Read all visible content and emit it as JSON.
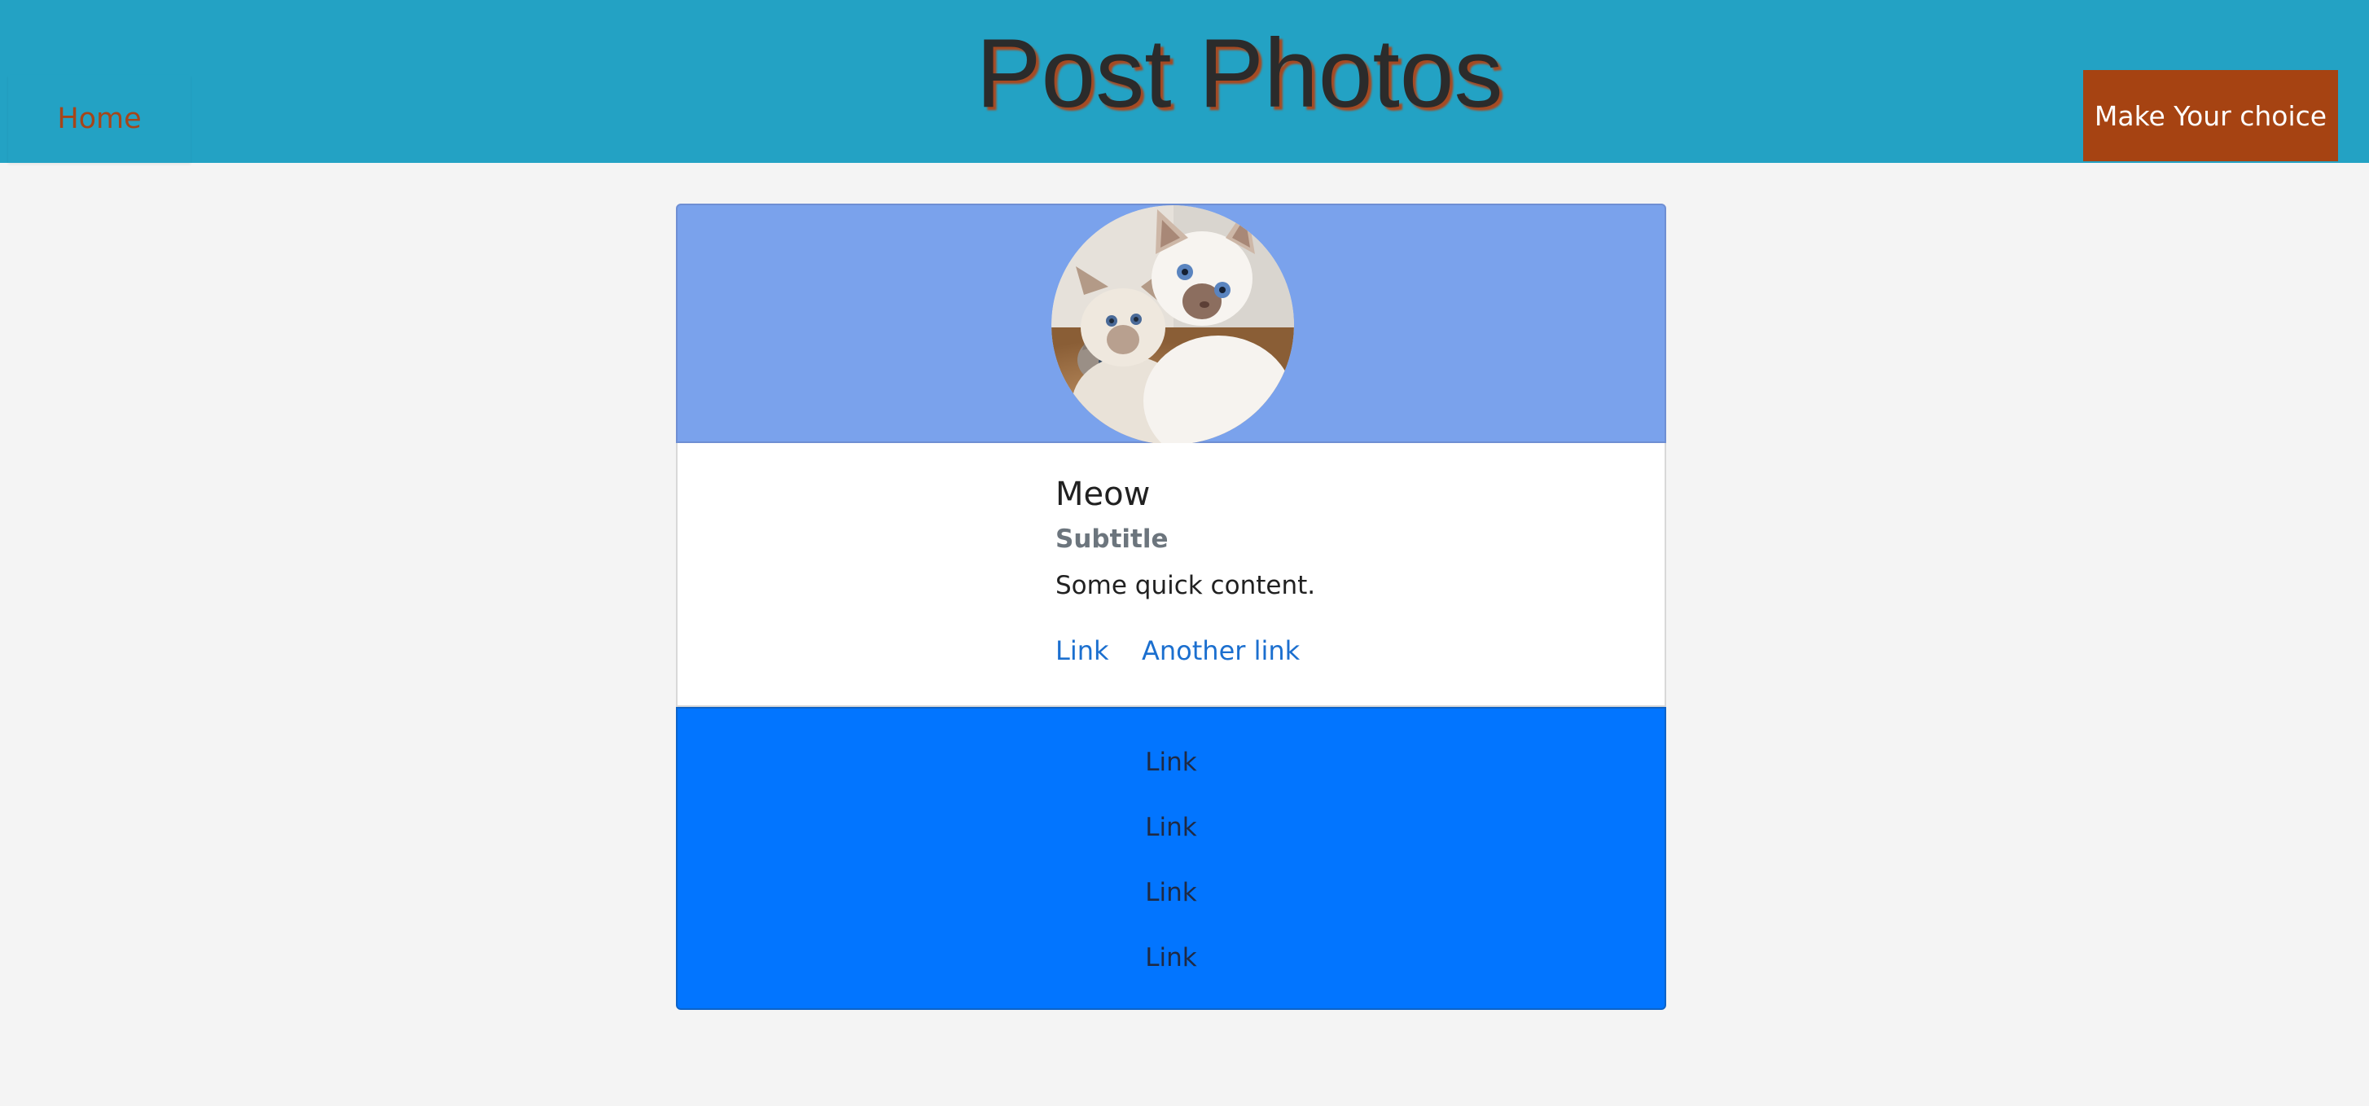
{
  "header": {
    "home_label": "Home",
    "title": "Post Photos",
    "choice_button_label": "Make Your choice"
  },
  "card": {
    "image_alt": "kittens photo",
    "title": "Meow",
    "subtitle": "Subtitle",
    "text": "Some quick content.",
    "links": [
      "Link",
      "Another link"
    ],
    "footer_links": [
      "Link",
      "Link",
      "Link",
      "Link"
    ]
  },
  "colors": {
    "header_bg": "#23a2c4",
    "accent_orange": "#a64312",
    "card_header_bg": "#7aa2ec",
    "card_footer_bg": "#0275ff",
    "link_blue": "#1b6fcf"
  }
}
